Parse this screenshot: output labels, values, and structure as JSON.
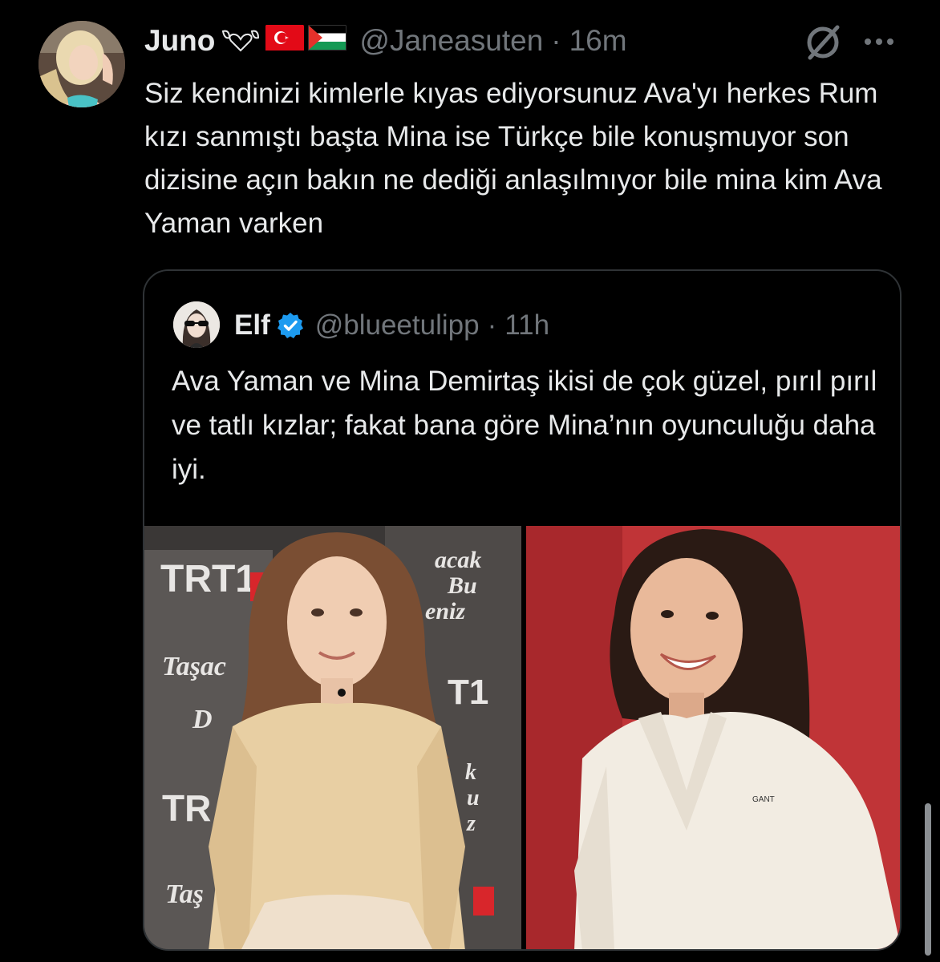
{
  "tweet": {
    "author_name": "Juno",
    "author_handle": "@Janeasuten",
    "separator": "·",
    "time": "16m",
    "text": "Siz kendinizi kimlerle kıyas ediyorsunuz Ava'yı herkes Rum kızı sanmıştı başta Mina ise Türkçe bile konuşmuyor son dizisine açın bakın ne dediği anlaşılmıyor bile mina kim Ava Yaman varken",
    "name_decorations": [
      "leaf-heart-emoji",
      "turkey-flag",
      "palestine-flag"
    ]
  },
  "actions": {
    "grok_icon": "grok-icon",
    "more_icon": "more-icon"
  },
  "quote": {
    "author_name": "Elf",
    "author_handle": "@blueetulipp",
    "separator": "·",
    "time": "11h",
    "verified": true,
    "text": "Ava Yaman ve Mina Demirtaş ikisi de çok güzel, pırıl pırıl ve tatlı kızlar; fakat bana göre Mina’nın oyunculuğu daha iyi.",
    "photos": [
      {
        "name": "left-photo",
        "backdrop_logo": "TRT1",
        "backdrop_lines": [
          "acak",
          "Bu",
          "eniz",
          "Taşac",
          "D",
          "TR",
          "Taş",
          "T1",
          "k",
          "u",
          "z"
        ]
      },
      {
        "name": "right-photo",
        "shirt_logo": "GANT"
      }
    ]
  },
  "colors": {
    "background": "#000000",
    "primary_text": "#e7e9ea",
    "secondary_text": "#71767b",
    "border": "#2f3336",
    "verified_blue": "#1d9bf0"
  }
}
